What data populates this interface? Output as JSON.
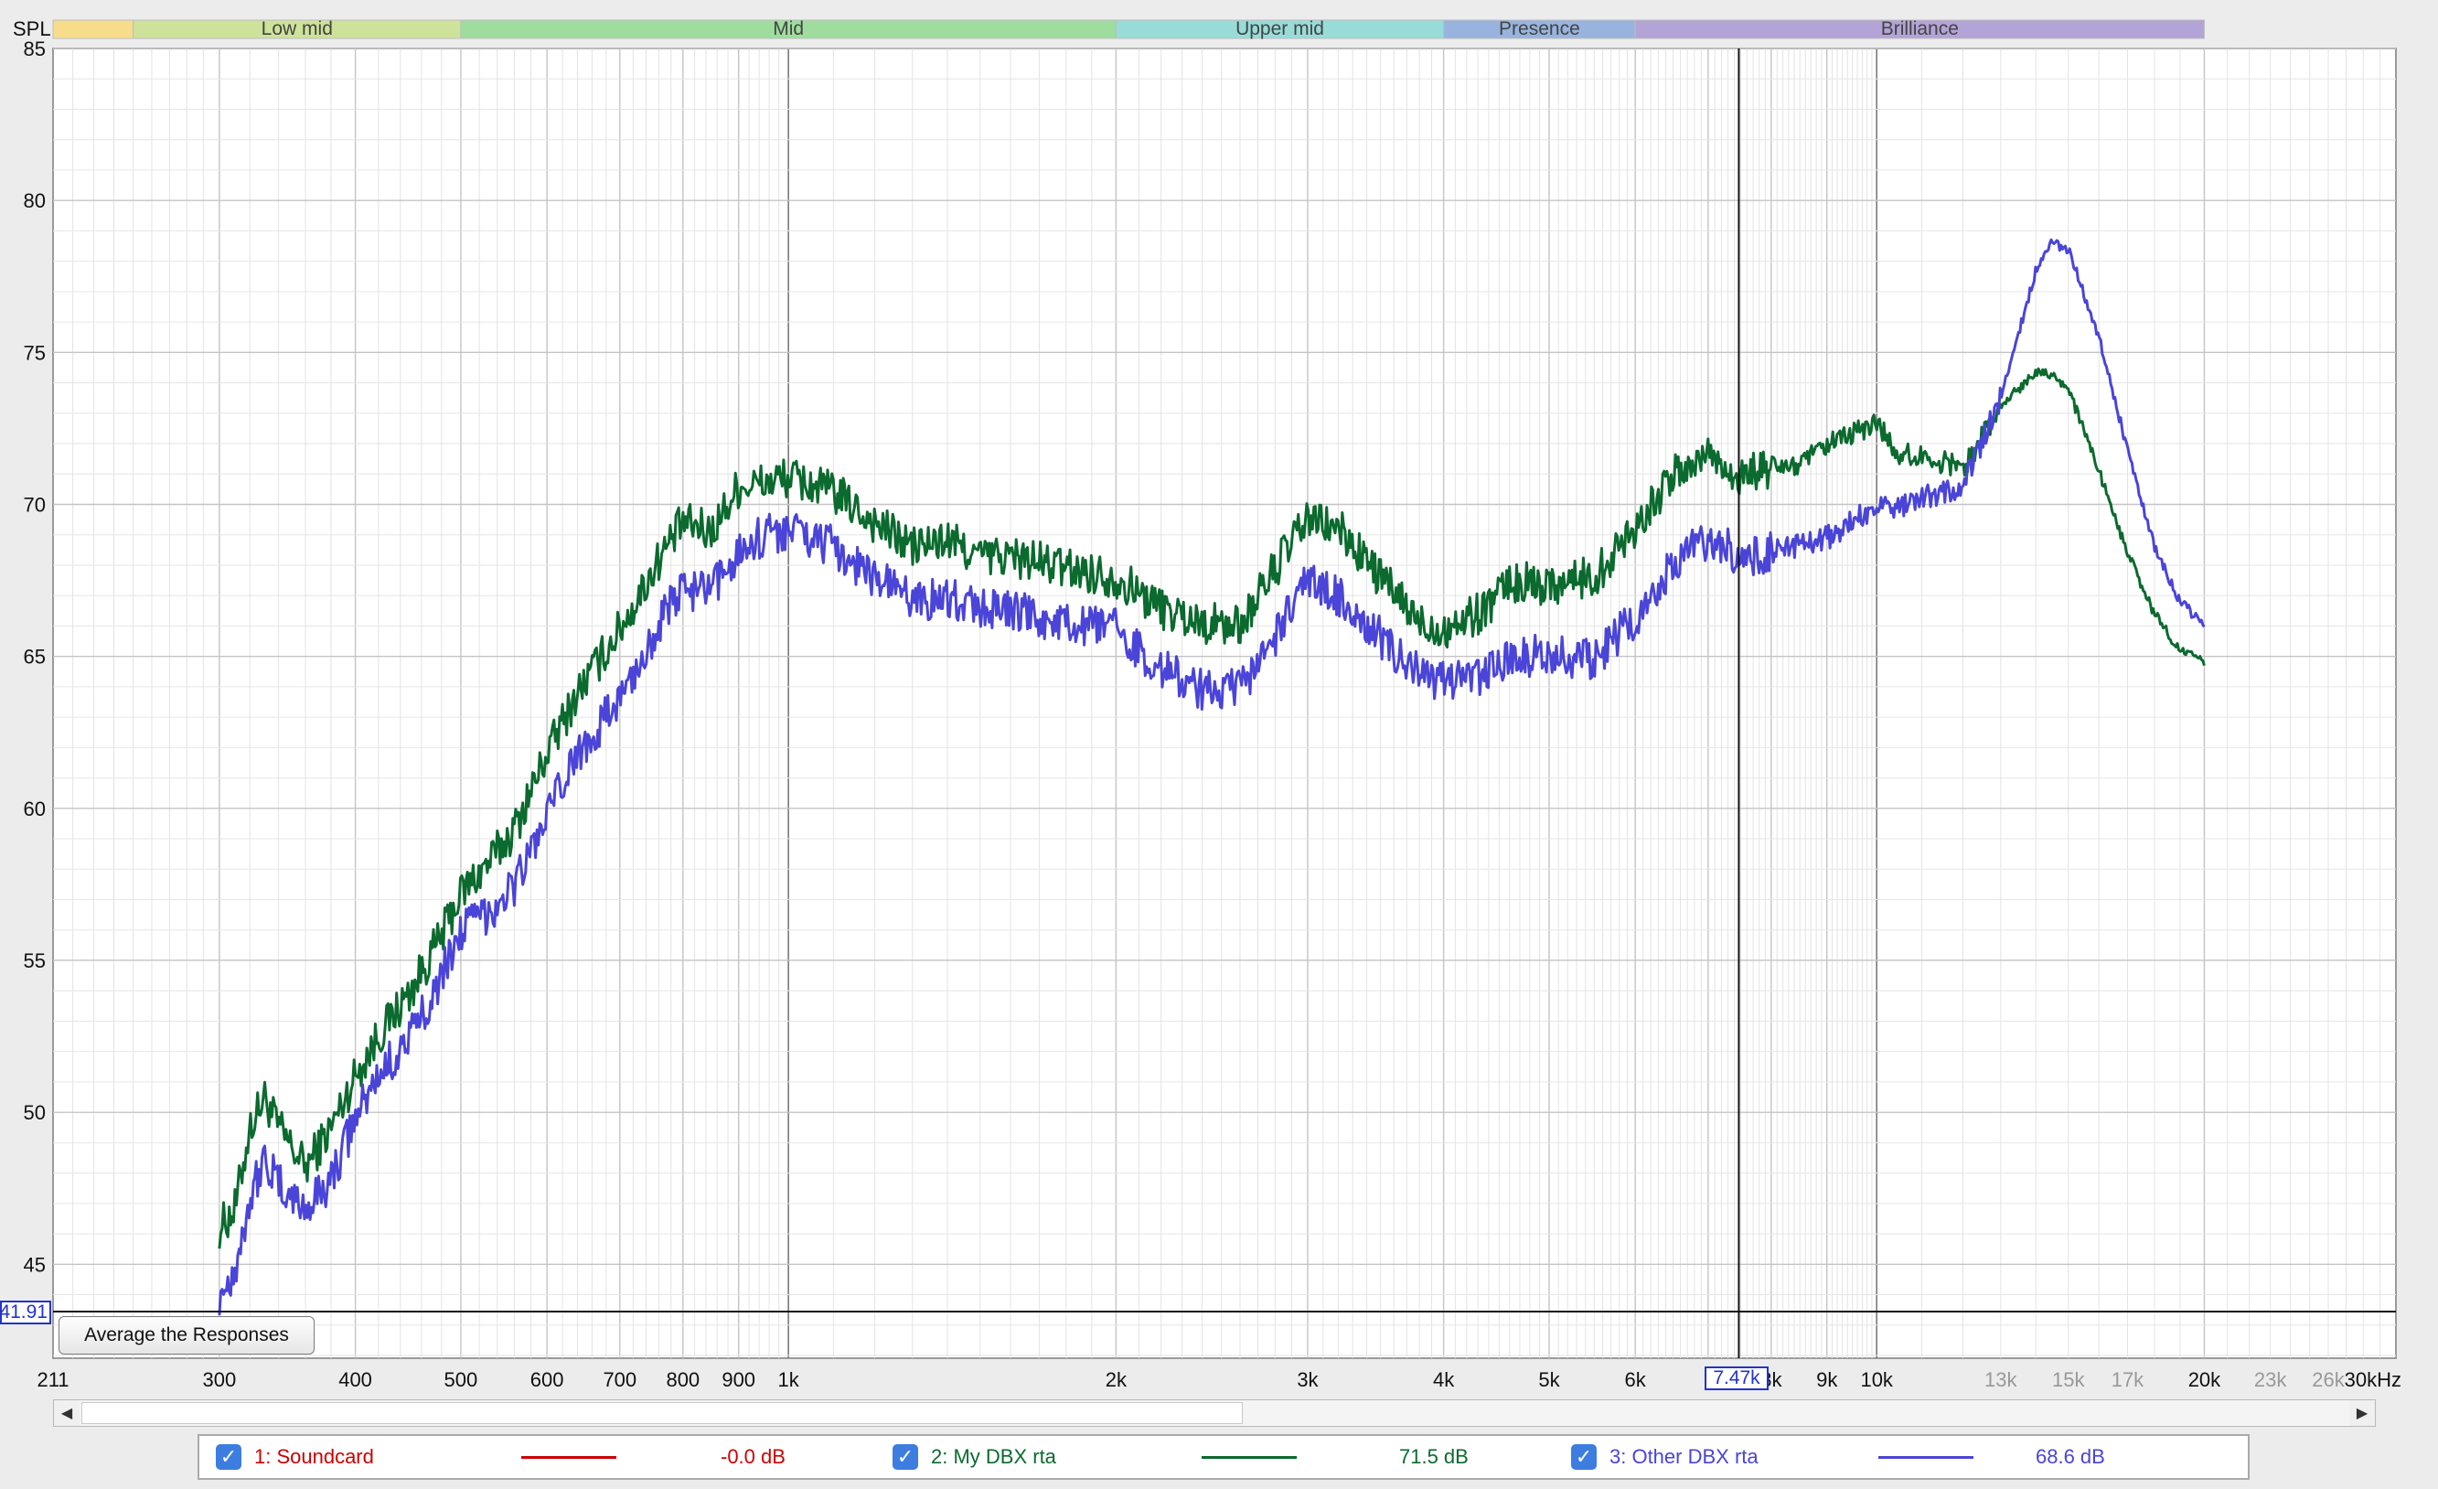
{
  "chart_data": {
    "type": "line",
    "ylabel": "SPL",
    "x_scale": "log",
    "xlim": [
      211,
      30000
    ],
    "ylim": [
      41.91,
      85
    ],
    "grid": true,
    "y_ticks": [
      85,
      80,
      75,
      70,
      65,
      60,
      55,
      50,
      45
    ],
    "x_tick_labels": [
      {
        "f": 211,
        "label": "211",
        "faint": false
      },
      {
        "f": 300,
        "label": "300",
        "faint": false
      },
      {
        "f": 400,
        "label": "400",
        "faint": false
      },
      {
        "f": 500,
        "label": "500",
        "faint": false
      },
      {
        "f": 600,
        "label": "600",
        "faint": false
      },
      {
        "f": 700,
        "label": "700",
        "faint": false
      },
      {
        "f": 800,
        "label": "800",
        "faint": false
      },
      {
        "f": 900,
        "label": "900",
        "faint": false
      },
      {
        "f": 1000,
        "label": "1k",
        "faint": false
      },
      {
        "f": 2000,
        "label": "2k",
        "faint": false
      },
      {
        "f": 3000,
        "label": "3k",
        "faint": false
      },
      {
        "f": 4000,
        "label": "4k",
        "faint": false
      },
      {
        "f": 5000,
        "label": "5k",
        "faint": false
      },
      {
        "f": 6000,
        "label": "6k",
        "faint": false
      },
      {
        "f": 8000,
        "label": "8k",
        "faint": false
      },
      {
        "f": 9000,
        "label": "9k",
        "faint": false
      },
      {
        "f": 10000,
        "label": "10k",
        "faint": false
      },
      {
        "f": 13000,
        "label": "13k",
        "faint": true
      },
      {
        "f": 15000,
        "label": "15k",
        "faint": true
      },
      {
        "f": 17000,
        "label": "17k",
        "faint": true
      },
      {
        "f": 20000,
        "label": "20k",
        "faint": false
      },
      {
        "f": 23000,
        "label": "23k",
        "faint": true
      },
      {
        "f": 26000,
        "label": "26k",
        "faint": true
      },
      {
        "f": 30000,
        "label": "30kHz",
        "faint": false
      }
    ],
    "bands": [
      {
        "label": "",
        "from": 211,
        "to": 250,
        "color": "#f7dc8c"
      },
      {
        "label": "Low mid",
        "from": 250,
        "to": 500,
        "color": "#cde39a"
      },
      {
        "label": "Mid",
        "from": 500,
        "to": 2000,
        "color": "#9edd9e"
      },
      {
        "label": "Upper mid",
        "from": 2000,
        "to": 4000,
        "color": "#98dcd8"
      },
      {
        "label": "Presence",
        "from": 4000,
        "to": 6000,
        "color": "#98b4de"
      },
      {
        "label": "Brilliance",
        "from": 6000,
        "to": 20000,
        "color": "#b4a3d6"
      }
    ],
    "cursor": {
      "x_label": "7.47k",
      "x_value": 7470,
      "y_label": "41.91",
      "y_value": 41.91
    },
    "series": [
      {
        "name": "2: My DBX rta",
        "color": "#0b6a2e",
        "x": [
          300,
          310,
          320,
          330,
          340,
          350,
          360,
          380,
          400,
          420,
          450,
          480,
          500,
          530,
          560,
          600,
          640,
          680,
          720,
          760,
          800,
          850,
          900,
          950,
          1000,
          1100,
          1200,
          1300,
          1400,
          1500,
          1600,
          1800,
          2000,
          2200,
          2400,
          2600,
          2800,
          3000,
          3200,
          3500,
          3800,
          4000,
          4300,
          4600,
          5000,
          5500,
          6000,
          6500,
          7000,
          7470,
          8000,
          8500,
          9000,
          9500,
          10000,
          10500,
          11000,
          12000,
          13000,
          14000,
          14500,
          15000,
          16000,
          17000,
          18000,
          19000,
          20000
        ],
        "y": [
          46.2,
          46.8,
          49.5,
          50.5,
          49.5,
          48.8,
          48.2,
          49.5,
          51.2,
          52.5,
          54.0,
          55.8,
          57.2,
          58.2,
          59.3,
          61.8,
          63.8,
          65.2,
          66.6,
          68.2,
          69.4,
          69.1,
          70.6,
          70.7,
          70.9,
          70.4,
          69.4,
          68.6,
          68.8,
          68.3,
          68.3,
          67.9,
          67.6,
          66.6,
          66.1,
          66.0,
          67.9,
          69.5,
          69.2,
          67.6,
          66.1,
          65.9,
          66.4,
          67.4,
          67.4,
          67.6,
          69.3,
          70.9,
          71.7,
          70.9,
          71.2,
          71.3,
          71.9,
          72.3,
          72.7,
          71.6,
          71.6,
          71.2,
          73.2,
          74.4,
          74.3,
          73.8,
          71.1,
          68.4,
          66.4,
          65.2,
          64.8
        ]
      },
      {
        "name": "3: Other DBX rta",
        "color": "#4a44d8",
        "x": [
          300,
          310,
          320,
          330,
          340,
          350,
          360,
          380,
          400,
          420,
          450,
          480,
          500,
          530,
          560,
          600,
          640,
          680,
          720,
          760,
          800,
          850,
          900,
          950,
          1000,
          1100,
          1200,
          1300,
          1400,
          1500,
          1600,
          1800,
          2000,
          2200,
          2400,
          2600,
          2800,
          3000,
          3200,
          3500,
          3800,
          4000,
          4300,
          4600,
          5000,
          5500,
          6000,
          6500,
          7000,
          7470,
          8000,
          8500,
          9000,
          9500,
          10000,
          10500,
          11000,
          12000,
          13000,
          14000,
          14500,
          15000,
          16000,
          17000,
          18000,
          19000,
          20000
        ],
        "y": [
          44.0,
          44.8,
          47.2,
          48.5,
          47.6,
          47.2,
          46.8,
          47.8,
          49.8,
          51.2,
          52.5,
          54.5,
          56.0,
          56.6,
          57.5,
          59.7,
          61.8,
          63.0,
          64.3,
          66.1,
          67.2,
          67.1,
          68.5,
          69.0,
          69.2,
          68.6,
          67.6,
          66.9,
          66.9,
          66.6,
          66.5,
          66.0,
          65.9,
          64.6,
          63.9,
          63.9,
          65.6,
          67.5,
          67.0,
          65.6,
          64.4,
          64.1,
          64.3,
          65.0,
          65.0,
          64.9,
          66.3,
          68.1,
          68.9,
          68.3,
          68.4,
          68.7,
          68.9,
          69.4,
          70.0,
          69.9,
          70.2,
          70.6,
          73.5,
          77.7,
          78.6,
          78.4,
          75.5,
          71.8,
          68.6,
          66.8,
          66.0
        ]
      }
    ]
  },
  "buttons": {
    "average": "Average the Responses"
  },
  "legend": {
    "items": [
      {
        "checked": true,
        "name": "1: Soundcard",
        "value": "-0.0 dB",
        "color": "#cc0000"
      },
      {
        "checked": true,
        "name": "2: My DBX rta",
        "value": "71.5 dB",
        "color": "#0b6a2e"
      },
      {
        "checked": true,
        "name": "3: Other DBX rta",
        "value": "68.6 dB",
        "color": "#4a44d8"
      }
    ]
  },
  "scrollbar": {
    "left_arrow": "◀",
    "right_arrow": "▶"
  }
}
